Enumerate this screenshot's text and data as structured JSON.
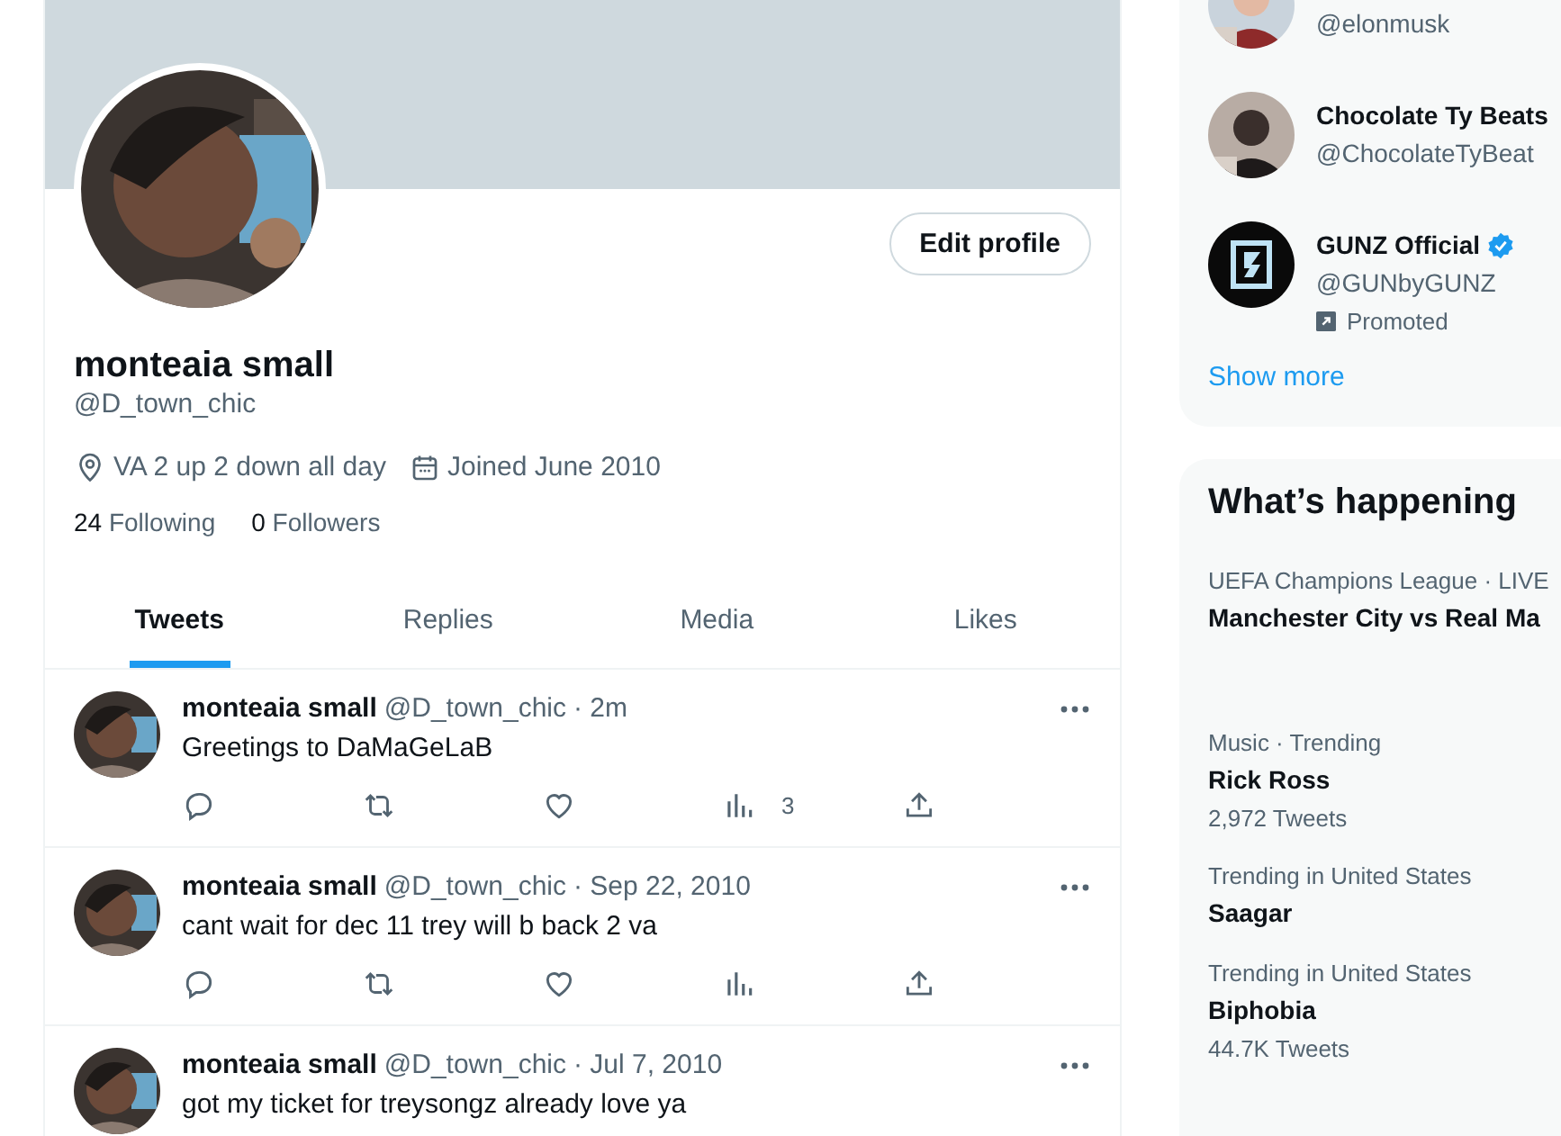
{
  "profile": {
    "button": "Edit profile",
    "name": "monteaia small",
    "handle": "@D_town_chic",
    "location": "VA 2 up 2 down all day",
    "joined": "Joined June 2010",
    "following_count": "24",
    "following_label": "Following",
    "followers_count": "0",
    "followers_label": "Followers"
  },
  "tabs": [
    {
      "label": "Tweets",
      "selected": true
    },
    {
      "label": "Replies",
      "selected": false
    },
    {
      "label": "Media",
      "selected": false
    },
    {
      "label": "Likes",
      "selected": false
    }
  ],
  "tweets": [
    {
      "name": "monteaia small",
      "handle": "@D_town_chic",
      "time": "· 2m",
      "text": "Greetings to DaMaGeLaB",
      "views": "3",
      "actions": true
    },
    {
      "name": "monteaia small",
      "handle": "@D_town_chic",
      "time": "· Sep 22, 2010",
      "text": "cant wait for dec 11 trey will b back 2 va",
      "actions": true
    },
    {
      "name": "monteaia small",
      "handle": "@D_town_chic",
      "time": "· Jul 7, 2010",
      "text": "got my ticket for treysongz already love ya"
    }
  ],
  "who_to_follow": {
    "users": [
      {
        "handle": "@elonmusk"
      },
      {
        "name": "Chocolate Ty Beats",
        "handle": "@ChocolateTyBeat"
      },
      {
        "name": "GUNZ Official",
        "handle": "@GUNbyGUNZ",
        "kind": "logo",
        "verified": true,
        "promoted": "Promoted"
      }
    ],
    "show_more": "Show more"
  },
  "whats_happening": {
    "title": "What’s happening",
    "trends": [
      {
        "kind": "event",
        "context": "UEFA Champions League · LIVE",
        "name": "Manchester City vs Real Ma"
      },
      {
        "kind": "trend",
        "context": "Music · Trending",
        "name": "Rick Ross",
        "count": "2,972 Tweets"
      },
      {
        "kind": "trend",
        "context": "Trending in United States",
        "name": "Saagar"
      },
      {
        "kind": "trend",
        "context": "Trending in United States",
        "name": "Biphobia",
        "count": "44.7K Tweets"
      }
    ]
  }
}
